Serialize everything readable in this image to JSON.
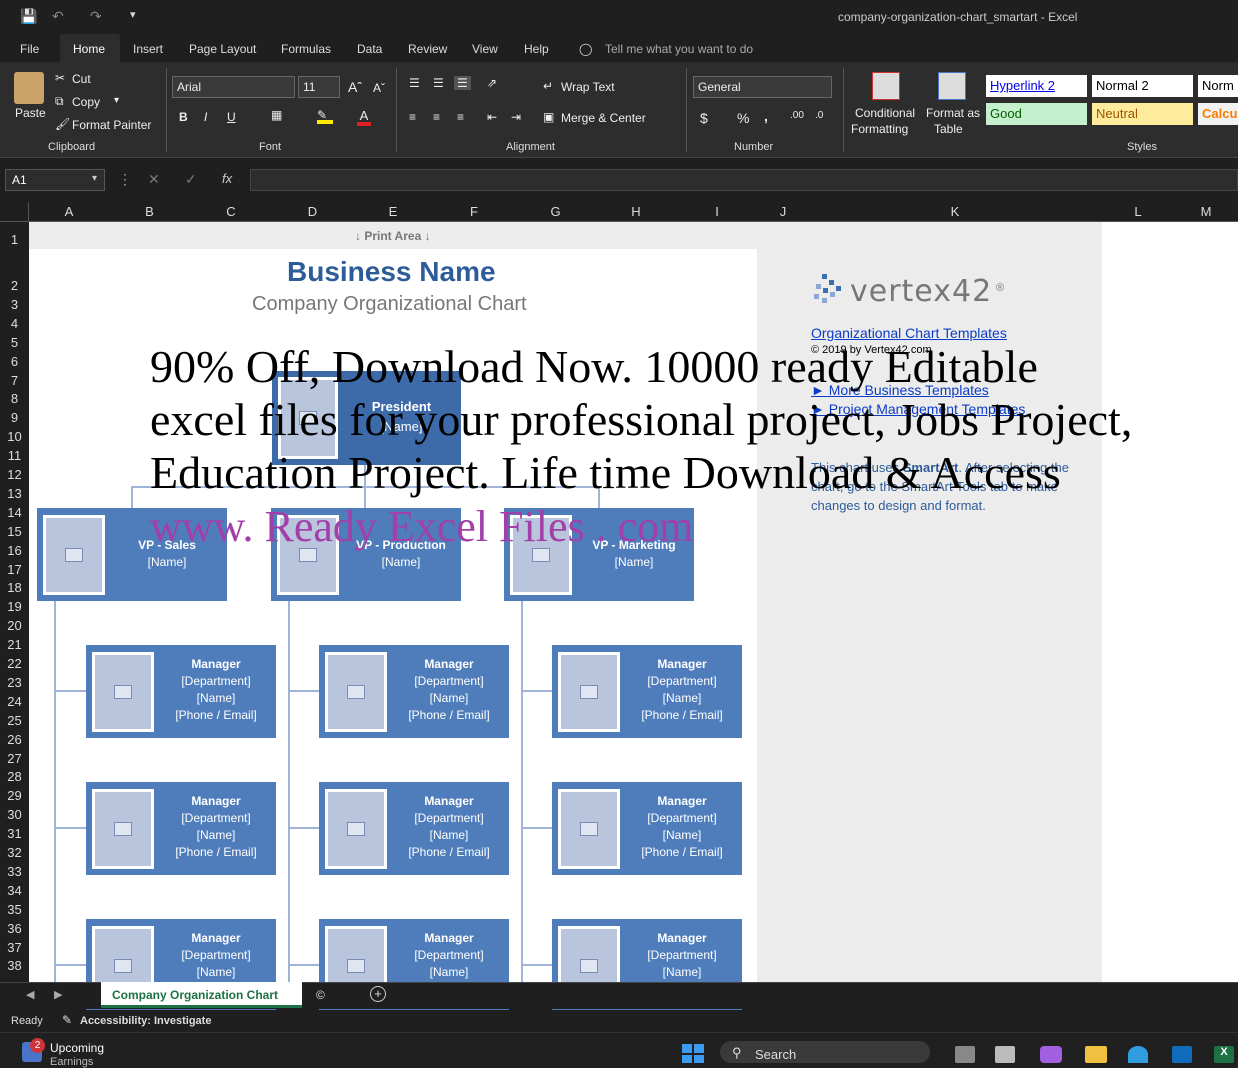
{
  "window": {
    "title": "company-organization-chart_smartart  -  Excel"
  },
  "menu": {
    "items": [
      "File",
      "Home",
      "Insert",
      "Page Layout",
      "Formulas",
      "Data",
      "Review",
      "View",
      "Help"
    ],
    "tell_me": "Tell me what you want to do"
  },
  "ribbon": {
    "clipboard": {
      "paste": "Paste",
      "cut": "Cut",
      "copy": "Copy",
      "format_painter": "Format Painter",
      "group": "Clipboard"
    },
    "font": {
      "name": "Arial",
      "size": "11",
      "group": "Font"
    },
    "alignment": {
      "wrap": "Wrap Text",
      "merge": "Merge & Center",
      "group": "Alignment"
    },
    "number": {
      "format": "General",
      "group": "Number",
      "currency": "$",
      "percent": "%",
      "comma": ","
    },
    "styles": {
      "conditional": "Conditional",
      "conditional2": "Formatting",
      "format_as": "Format as",
      "format_as2": "Table",
      "group": "Styles",
      "cells": [
        {
          "label": "Hyperlink 2"
        },
        {
          "label": "Normal 2"
        },
        {
          "label": "Norm"
        },
        {
          "label": "Good"
        },
        {
          "label": "Neutral"
        },
        {
          "label": "Calcu"
        }
      ]
    }
  },
  "formula_bar": {
    "name_box": "A1",
    "value": "",
    "fx": "fx"
  },
  "columns": [
    "A",
    "B",
    "C",
    "D",
    "E",
    "F",
    "G",
    "H",
    "I",
    "J",
    "K",
    "L",
    "M"
  ],
  "rows": [
    "1",
    "2",
    "3",
    "4",
    "5",
    "6",
    "7",
    "8",
    "9",
    "10",
    "11",
    "12",
    "13",
    "14",
    "15",
    "16",
    "17",
    "18",
    "19",
    "20",
    "21",
    "22",
    "23",
    "24",
    "25",
    "26",
    "27",
    "28",
    "29",
    "30",
    "31",
    "32",
    "33",
    "34",
    "35",
    "36",
    "37",
    "38"
  ],
  "sheet": {
    "print_area": "↓ Print Area ↓",
    "business_name": "Business Name",
    "subtitle": "Company Organizational Chart",
    "president": {
      "title": "President",
      "name": "[Name]"
    },
    "vps": [
      {
        "title": "VP - Sales",
        "name": "[Name]"
      },
      {
        "title": "VP - Production",
        "name": "[Name]"
      },
      {
        "title": "VP - Marketing",
        "name": "[Name]"
      }
    ],
    "manager": {
      "title": "Manager",
      "dept": "[Department]",
      "name": "[Name]",
      "contact": "[Phone / Email]"
    },
    "side": {
      "logo": "vertex42",
      "logo_reg": "®",
      "link1": "Organizational Chart Templates",
      "copyright": "© 2019 by Vertex42.com",
      "link2": "► More Business Templates",
      "link3": "► Project Management Templates",
      "note_pre": "This chart uses ",
      "note_bold": "SmartArt",
      "note_post": ". After selecting the chart, go to the SmartArt Tools tab to make changes to design and format."
    },
    "watermark": {
      "line1": "90% Off, Download Now. 10000 ready Editable",
      "line2": "excel files for your professional project, Jobs Project,",
      "line3": "Education Project. Life time Download & Access",
      "line4": "www. Ready Excel Files . com",
      "line4_color": "#a23fa8"
    }
  },
  "sheet_tabs": {
    "active": "Company Organization Chart",
    "other": "©"
  },
  "status": {
    "ready": "Ready",
    "accessibility": "Accessibility: Investigate"
  },
  "taskbar": {
    "notif_count": "2",
    "notif_text": "Upcoming",
    "notif_sub": "Earnings",
    "search": "Search"
  }
}
